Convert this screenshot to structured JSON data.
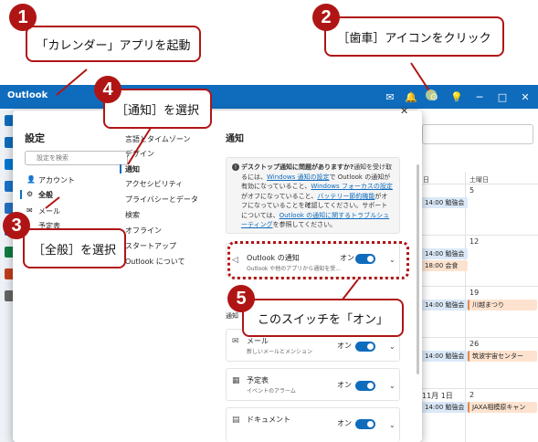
{
  "app": {
    "title": "Outlook"
  },
  "settings": {
    "title": "設定",
    "search_placeholder": "設定を検索",
    "nav": [
      {
        "label": "アカウント"
      },
      {
        "label": "全般"
      },
      {
        "label": "メール"
      },
      {
        "label": "予定表"
      }
    ],
    "subnav_partial": [
      "言語とタイムゾーン",
      "デザイン"
    ],
    "subnav": [
      {
        "label": "通知"
      },
      {
        "label": "アクセシビリティ"
      },
      {
        "label": "プライバシーとデータ"
      },
      {
        "label": "検索"
      },
      {
        "label": "オフライン"
      },
      {
        "label": "スタートアップ"
      },
      {
        "label": "Outlook について"
      }
    ],
    "section_title": "通知",
    "info": {
      "line1_bold": "デスクトップ通知に問題がありますか?",
      "line1": "通知を受け取るには、",
      "link1": "Windows 通知の設定",
      "text2": "で Outlook の通知が有効になっていること、",
      "link2": "Windows フォーカスの設定",
      "text3": "がオフになっていること、",
      "link3": "バッテリー節約機能",
      "text4": "がオフになっていることを確認してください。サポートについては、",
      "link4": "Outlook の通知に関するトラブルシューティング",
      "text5": "を参照してください。"
    },
    "cards": [
      {
        "title": "Outlook の通知",
        "subtitle": "Outlook や他のアプリから通知を受...",
        "state": "オン"
      },
      {
        "title": "メール",
        "subtitle": "新しいメールとメンション",
        "state": "オン"
      },
      {
        "title": "予定表",
        "subtitle": "イベントのアラーム",
        "state": "オン"
      },
      {
        "title": "ドキュメント",
        "subtitle": "",
        "state": "オン"
      }
    ],
    "partial_label": "通知"
  },
  "calendar": {
    "header_a": "日",
    "header_b": "土曜日",
    "rows": [
      {
        "a_events": [
          {
            "text": "14:00 勉強会",
            "color": "blue"
          }
        ],
        "b_date": "5",
        "b_events": []
      },
      {
        "a_events": [
          {
            "text": "14:00 勉強会",
            "color": "blue"
          },
          {
            "text": "18:00 会食",
            "color": "orange"
          }
        ],
        "b_date": "12",
        "b_events": []
      },
      {
        "a_events": [
          {
            "text": "14:00 勉強会",
            "color": "blue"
          }
        ],
        "b_date": "19",
        "b_events": [
          {
            "text": "川越まつり",
            "color": "orange"
          }
        ]
      },
      {
        "a_events": [
          {
            "text": "14:00 勉強会",
            "color": "blue"
          }
        ],
        "b_date": "26",
        "b_events": [
          {
            "text": "筑波宇宙センター",
            "color": "orange"
          }
        ]
      },
      {
        "a_date": "11月 1日",
        "a_events": [
          {
            "text": "14:00 勉強会",
            "color": "blue"
          }
        ],
        "b_date": "2",
        "b_events": [
          {
            "text": "JAXA相模原キャン",
            "color": "orange"
          }
        ]
      }
    ]
  },
  "callouts": [
    {
      "number": "1",
      "text": "「カレンダー」アプリを起動"
    },
    {
      "number": "2",
      "text": "［歯車］アイコンをクリック"
    },
    {
      "number": "3",
      "text": "［全般］を選択"
    },
    {
      "number": "4",
      "text": "［通知］を選択"
    },
    {
      "number": "5",
      "text": "このスイッチを「オン」"
    }
  ],
  "colors": {
    "accent": "#0f6cbd",
    "callout": "#b01515",
    "event_orange": "#e8884a"
  }
}
